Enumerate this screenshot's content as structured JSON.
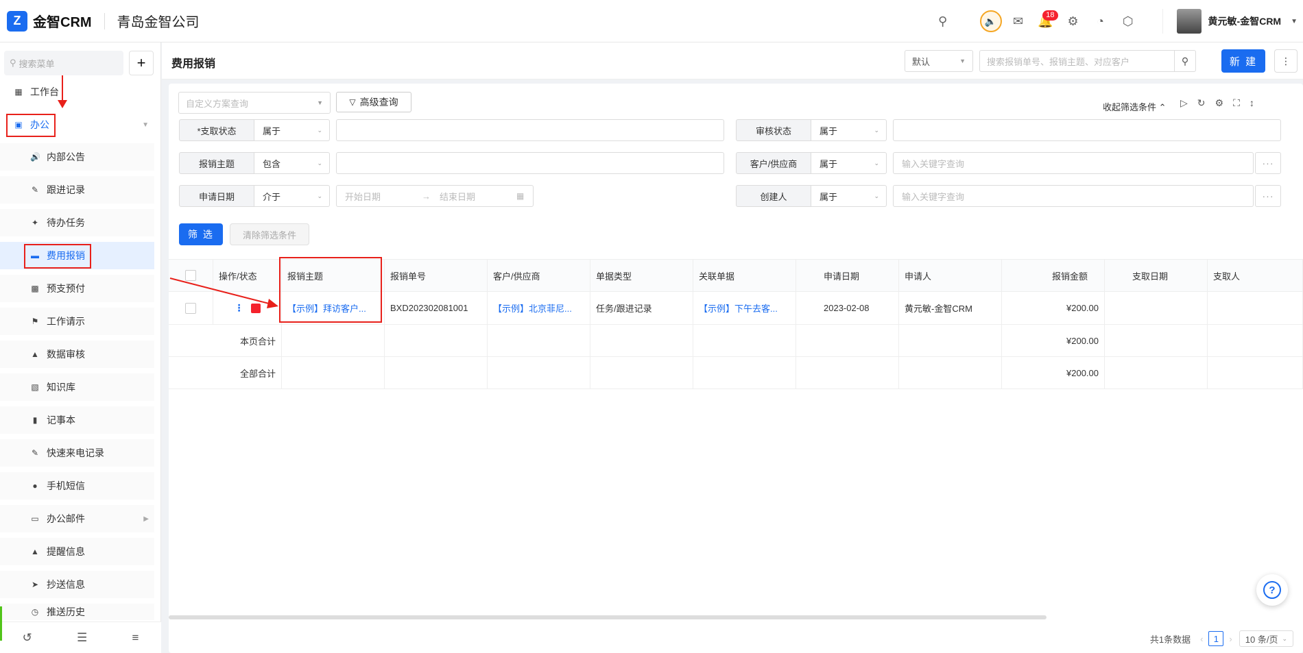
{
  "header": {
    "logo_char": "Z",
    "app_name": "金智CRM",
    "company": "青岛金智公司",
    "notification_count": "18",
    "user_name": "黄元敏-金智CRM"
  },
  "sidebar": {
    "search_placeholder": "搜索菜单",
    "add_label": "+",
    "workbench": "工作台",
    "office": "办公",
    "items": [
      {
        "label": "内部公告"
      },
      {
        "label": "跟进记录"
      },
      {
        "label": "待办任务"
      },
      {
        "label": "费用报销"
      },
      {
        "label": "预支预付"
      },
      {
        "label": "工作请示"
      },
      {
        "label": "数据审核"
      },
      {
        "label": "知识库"
      },
      {
        "label": "记事本"
      },
      {
        "label": "快速来电记录"
      },
      {
        "label": "手机短信"
      },
      {
        "label": "办公邮件"
      },
      {
        "label": "提醒信息"
      },
      {
        "label": "抄送信息"
      },
      {
        "label": "推送历史"
      }
    ]
  },
  "page": {
    "title": "费用报销",
    "view_select": "默认",
    "search_placeholder": "搜索报销单号、报销主题、对应客户",
    "new_label": "新 建"
  },
  "filters": {
    "scheme_placeholder": "自定义方案查询",
    "advanced_label": "高级查询",
    "collapse_label": "收起筛选条件",
    "rows": {
      "pay_status": {
        "label": "*支取状态",
        "op": "属于"
      },
      "audit_status": {
        "label": "审核状态",
        "op": "属于"
      },
      "subject": {
        "label": "报销主题",
        "op": "包含"
      },
      "customer": {
        "label": "客户/供应商",
        "op": "属于",
        "placeholder": "输入关键字查询"
      },
      "apply_date": {
        "label": "申请日期",
        "op": "介于",
        "start": "开始日期",
        "end": "结束日期"
      },
      "creator": {
        "label": "创建人",
        "op": "属于",
        "placeholder": "输入关键字查询"
      }
    },
    "filter_label": "筛 选",
    "clear_label": "清除筛选条件"
  },
  "table": {
    "columns": [
      "操作/状态",
      "报销主题",
      "报销单号",
      "客户/供应商",
      "单据类型",
      "关联单据",
      "申请日期",
      "申请人",
      "报销金额",
      "支取日期",
      "支取人"
    ],
    "row": {
      "subject": "【示例】拜访客户...",
      "number": "BXD202302081001",
      "customer": "【示例】北京菲尼...",
      "doc_type": "任务/跟进记录",
      "related": "【示例】下午去客...",
      "date": "2023-02-08",
      "applicant": "黄元敏-金智CRM",
      "amount": "¥200.00"
    },
    "page_total_label": "本页合计",
    "page_total": "¥200.00",
    "all_total_label": "全部合计",
    "all_total": "¥200.00"
  },
  "footer": {
    "total_text": "共1条数据",
    "current_page": "1",
    "page_size": "10 条/页"
  },
  "colors": {
    "accent": "#1a6cf0",
    "annotation": "#e8201a"
  }
}
